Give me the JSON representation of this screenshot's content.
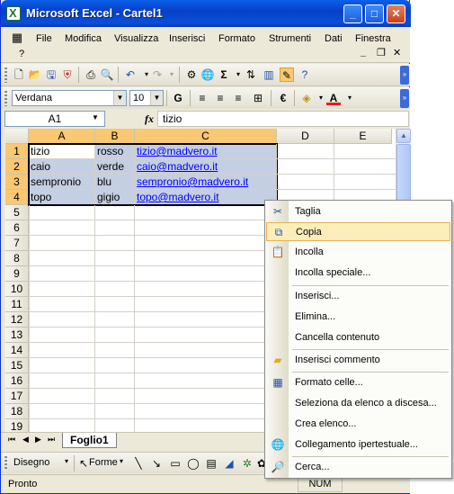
{
  "window": {
    "title": "Microsoft Excel - Cartel1"
  },
  "titlebar": {
    "min": "_",
    "max": "□",
    "close": "✕"
  },
  "menubar": {
    "items": [
      "File",
      "Modifica",
      "Visualizza",
      "Inserisci",
      "Formato",
      "Strumenti",
      "Dati",
      "Finestra",
      "?"
    ],
    "mdi_min": "_",
    "mdi_restore": "❐",
    "mdi_close": "✕"
  },
  "formatting": {
    "font": "Verdana",
    "size": "10",
    "bold": "G",
    "currency": "€",
    "font_color": "A"
  },
  "standard": {
    "sum": "Σ"
  },
  "formula_bar": {
    "name_box": "A1",
    "fx": "fx",
    "content": "tizio"
  },
  "columns": [
    "A",
    "B",
    "C",
    "D",
    "E"
  ],
  "rows": [
    "1",
    "2",
    "3",
    "4",
    "5",
    "6",
    "7",
    "8",
    "9",
    "10",
    "11",
    "12",
    "13",
    "14",
    "15",
    "16",
    "17",
    "18",
    "19"
  ],
  "cells": [
    [
      "tizio",
      "rosso",
      "tizio@madvero.it"
    ],
    [
      "caio",
      "verde",
      "caio@madvero.it"
    ],
    [
      "sempronio",
      "blu",
      "sempronio@madvero.it"
    ],
    [
      "topo",
      "gigio",
      "topo@madvero.it"
    ]
  ],
  "sheet_tabs": [
    "Foglio1"
  ],
  "draw_toolbar": {
    "draw": "Disegno",
    "shapes": "Forme"
  },
  "status": {
    "text": "Pronto",
    "num": "NUM"
  },
  "context_menu": {
    "items": [
      {
        "label": "Taglia",
        "icon": "scissors-icon"
      },
      {
        "label": "Copia",
        "icon": "copy-icon",
        "highlighted": true
      },
      {
        "label": "Incolla",
        "icon": "paste-icon"
      },
      {
        "label": "Incolla speciale...",
        "icon": ""
      },
      {
        "label": "Inserisci...",
        "icon": ""
      },
      {
        "label": "Elimina...",
        "icon": ""
      },
      {
        "label": "Cancella contenuto",
        "icon": ""
      },
      {
        "label": "Inserisci commento",
        "icon": "comment-icon"
      },
      {
        "label": "Formato celle...",
        "icon": "format-cells-icon"
      },
      {
        "label": "Seleziona da elenco a discesa...",
        "icon": ""
      },
      {
        "label": "Crea elenco...",
        "icon": ""
      },
      {
        "label": "Collegamento ipertestuale...",
        "icon": "hyperlink-icon"
      },
      {
        "label": "Cerca...",
        "icon": "search-icon"
      }
    ]
  },
  "colors": {
    "selection": "#c5cfe3",
    "header_selected": "#f8c872",
    "link": "#0000ff",
    "menu_highlight": "#fbeebb"
  }
}
